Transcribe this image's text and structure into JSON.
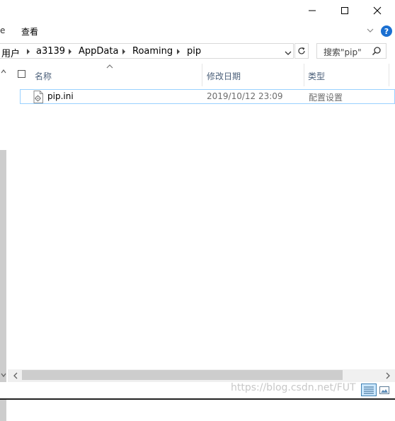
{
  "window": {
    "controls": {
      "minimize": "minimize-icon",
      "maximize": "maximize-icon",
      "close": "close-icon"
    }
  },
  "ribbon": {
    "left_fragment": "e",
    "tab_view": "查看",
    "expand_icon": "chevron-down-icon",
    "help_icon_label": "?"
  },
  "address": {
    "crumbs": [
      "用户",
      "a3139",
      "AppData",
      "Roaming",
      "pip"
    ],
    "search_placeholder": "搜索\"pip\""
  },
  "columns": {
    "name": "名称",
    "modified": "修改日期",
    "type": "类型"
  },
  "files": [
    {
      "name": "pip.ini",
      "modified": "2019/10/12 23:09",
      "type": "配置设置",
      "icon": "ini-file-icon"
    }
  ],
  "watermark": "https://blog.csdn.net/FUT",
  "colors": {
    "selection_border": "#99d1ff",
    "help_blue": "#1a6fd1",
    "header_text": "#4c607a"
  }
}
